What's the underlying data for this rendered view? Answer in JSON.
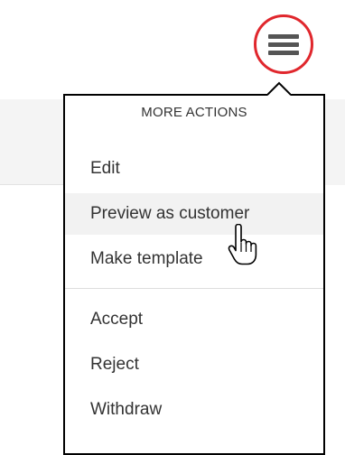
{
  "menu_button": {
    "icon": "hamburger-icon",
    "highlight_color": "#e0272d"
  },
  "dropdown": {
    "header": "MORE ACTIONS",
    "items": [
      {
        "label": "Edit"
      },
      {
        "label": "Preview as customer"
      },
      {
        "label": "Make template"
      },
      {
        "label": "Accept"
      },
      {
        "label": "Reject"
      },
      {
        "label": "Withdraw"
      }
    ]
  },
  "cursor": {
    "icon": "hand-pointer-icon"
  }
}
